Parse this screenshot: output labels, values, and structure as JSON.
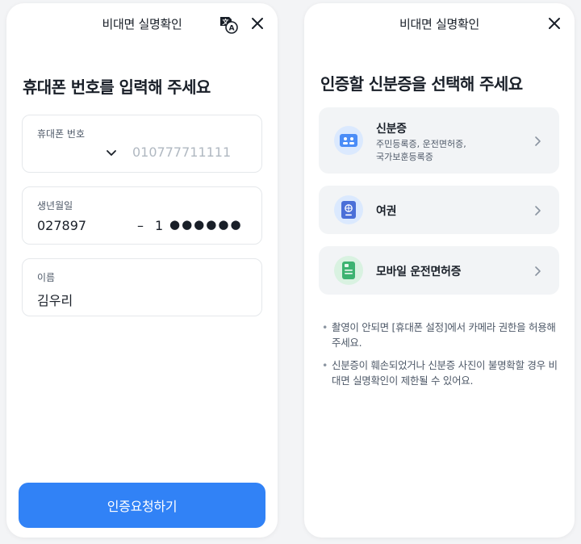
{
  "left_panel": {
    "header_title": "비대면 실명확인",
    "page_title": "휴대폰 번호를 입력해 주세요",
    "phone": {
      "label": "휴대폰 번호",
      "placeholder": "010777711111"
    },
    "birth": {
      "label": "생년월일",
      "value": "027897",
      "dash": "–",
      "gender_digit": "1",
      "masked": "●●●●●●"
    },
    "name": {
      "label": "이름",
      "value": "김우리"
    },
    "submit_label": "인증요청하기"
  },
  "right_panel": {
    "header_title": "비대면 실명확인",
    "page_title": "인증할 신분증을 선택해 주세요",
    "cards": [
      {
        "title": "신분증",
        "desc_line1": "주민등록증, 운전면허증,",
        "desc_line2": "국가보훈등록증",
        "icon": "id-card-icon"
      },
      {
        "title": "여권",
        "icon": "passport-icon"
      },
      {
        "title": "모바일 운전면허증",
        "icon": "mobile-license-icon"
      }
    ],
    "notes": [
      "촬영이 안되면 [휴대폰 설정]에서 카메라 권한을 허용해 주세요.",
      "신분증이 훼손되었거나 신분증 사진이 불명확할 경우 비대면 실명확인이 제한될 수 있어요."
    ]
  },
  "colors": {
    "primary": "#3182f6",
    "text": "#191f28",
    "subtext": "#4e5968",
    "placeholder": "#b0b8c1",
    "card_bg": "#f2f4f6",
    "border": "#e5e8eb"
  }
}
